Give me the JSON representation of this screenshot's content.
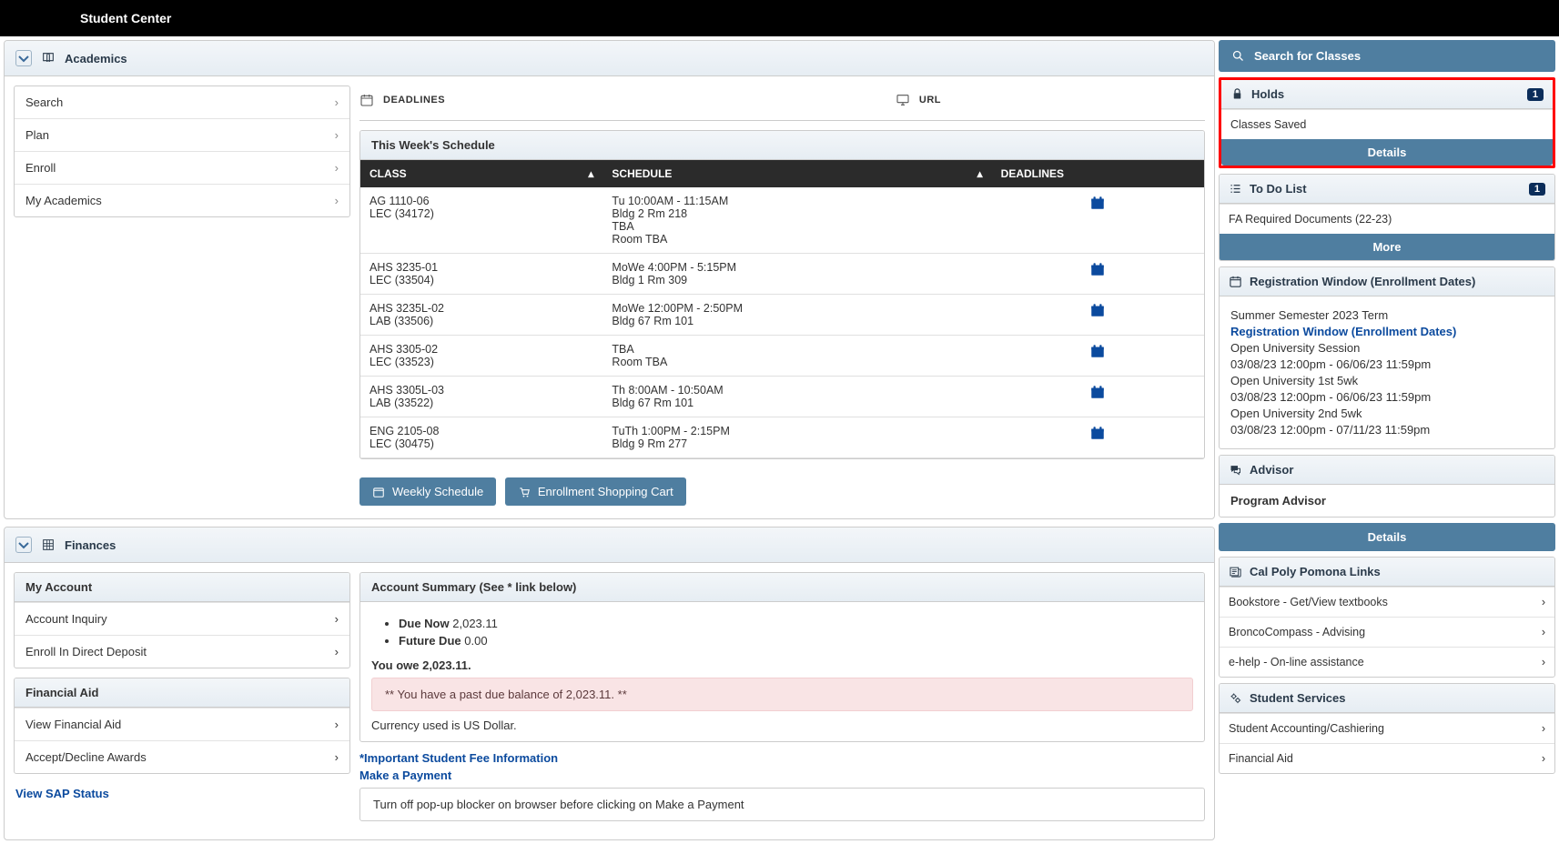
{
  "header": {
    "title": "Student Center"
  },
  "academics": {
    "title": "Academics",
    "nav": [
      {
        "label": "Search"
      },
      {
        "label": "Plan"
      },
      {
        "label": "Enroll"
      },
      {
        "label": "My Academics"
      }
    ],
    "toolbar": {
      "deadlines": "DEADLINES",
      "url": "URL"
    },
    "schedule_title": "This Week's Schedule",
    "cols": {
      "class": "CLASS",
      "schedule": "SCHEDULE",
      "deadlines": "DEADLINES"
    },
    "rows": [
      {
        "class": "AG 1110-06\nLEC (34172)",
        "schedule": "Tu 10:00AM - 11:15AM\nBldg 2 Rm 218\nTBA\nRoom  TBA"
      },
      {
        "class": "AHS 3235-01\nLEC (33504)",
        "schedule": "MoWe 4:00PM - 5:15PM\nBldg 1 Rm 309"
      },
      {
        "class": "AHS 3235L-02\nLAB (33506)",
        "schedule": "MoWe 12:00PM - 2:50PM\nBldg 67 Rm 101"
      },
      {
        "class": "AHS 3305-02\nLEC (33523)",
        "schedule": "TBA\nRoom  TBA"
      },
      {
        "class": "AHS 3305L-03\nLAB (33522)",
        "schedule": "Th 8:00AM - 10:50AM\nBldg 67 Rm 101"
      },
      {
        "class": "ENG 2105-08\nLEC (30475)",
        "schedule": "TuTh 1:00PM - 2:15PM\nBldg 9 Rm 277"
      }
    ],
    "btn_weekly": "Weekly Schedule",
    "btn_cart": "Enrollment Shopping Cart"
  },
  "finances": {
    "title": "Finances",
    "my_account": {
      "title": "My Account",
      "items": [
        "Account Inquiry",
        "Enroll In Direct Deposit"
      ]
    },
    "fin_aid": {
      "title": "Financial Aid",
      "items": [
        "View Financial Aid",
        "Accept/Decline Awards"
      ]
    },
    "sap_link": "View SAP Status",
    "summary_title": "Account Summary (See * link below)",
    "due_now_label": "Due Now",
    "due_now_val": "2,023.11",
    "future_due_label": "Future Due",
    "future_due_val": "0.00",
    "owe": "You owe 2,023.11.",
    "past_due": "** You have a past due balance of 2,023.11. **",
    "currency": "Currency used is US Dollar.",
    "fee_link": "*Important Student Fee Information",
    "pay_link": "Make a Payment",
    "popup_note": "Turn off pop-up blocker on browser before clicking on Make a Payment"
  },
  "side": {
    "search": "Search for Classes",
    "holds": {
      "title": "Holds",
      "badge": "1",
      "item": "Classes Saved",
      "details": "Details"
    },
    "todo": {
      "title": "To Do List",
      "badge": "1",
      "item": "FA Required Documents (22-23)",
      "more": "More"
    },
    "reg": {
      "title": "Registration Window (Enrollment Dates)",
      "term": "Summer Semester 2023 Term",
      "link": "Registration Window (Enrollment Dates)",
      "lines": [
        "Open University Session",
        "03/08/23 12:00pm - 06/06/23 11:59pm",
        "Open University 1st 5wk",
        "03/08/23 12:00pm - 06/06/23 11:59pm",
        "Open University 2nd 5wk",
        "03/08/23 12:00pm - 07/11/23 11:59pm"
      ]
    },
    "advisor": {
      "title": "Advisor",
      "name": "Program Advisor",
      "details": "Details"
    },
    "links": {
      "title": "Cal Poly Pomona Links",
      "items": [
        "Bookstore - Get/View textbooks",
        "BroncoCompass - Advising",
        "e-help - On-line assistance"
      ]
    },
    "services": {
      "title": "Student Services",
      "items": [
        "Student Accounting/Cashiering",
        "Financial Aid"
      ]
    }
  }
}
